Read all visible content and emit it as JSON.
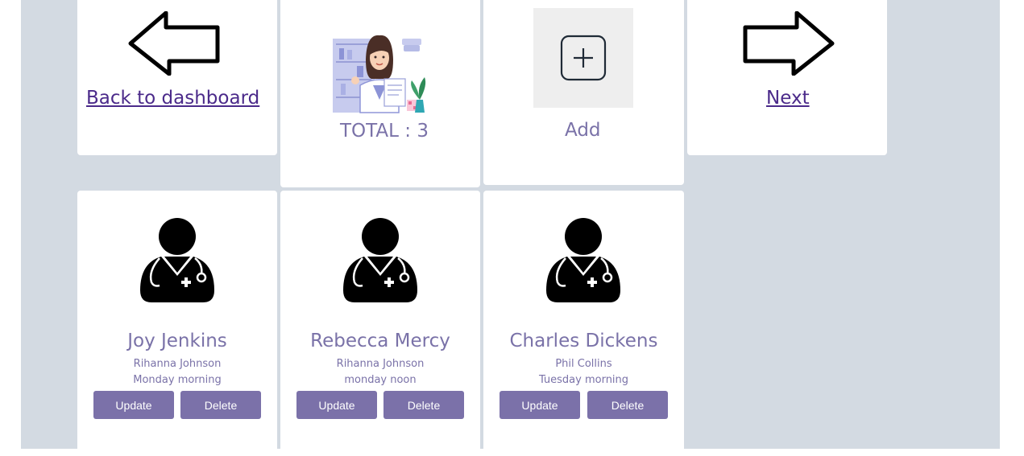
{
  "nav": {
    "back_label": "Back to dashboard",
    "next_label": "Next"
  },
  "summary": {
    "total_label": "TOTAL : 3"
  },
  "add": {
    "label": "Add"
  },
  "doctors": [
    {
      "name": "Joy Jenkins",
      "assistant": "Rihanna Johnson",
      "schedule": "Monday morning",
      "update_label": "Update",
      "delete_label": "Delete"
    },
    {
      "name": "Rebecca Mercy",
      "assistant": "Rihanna Johnson",
      "schedule": "monday noon",
      "update_label": "Update",
      "delete_label": "Delete"
    },
    {
      "name": "Charles Dickens",
      "assistant": "Phil Collins",
      "schedule": "Tuesday morning",
      "update_label": "Update",
      "delete_label": "Delete"
    }
  ],
  "colors": {
    "background_panel": "#d3dae2",
    "accent": "#7b71a9",
    "link": "#4b2a8a",
    "text": "#7a72a8"
  },
  "icons": [
    "back-arrow-icon",
    "doctor-illustration",
    "add-icon",
    "next-arrow-icon",
    "doctor-icon"
  ]
}
